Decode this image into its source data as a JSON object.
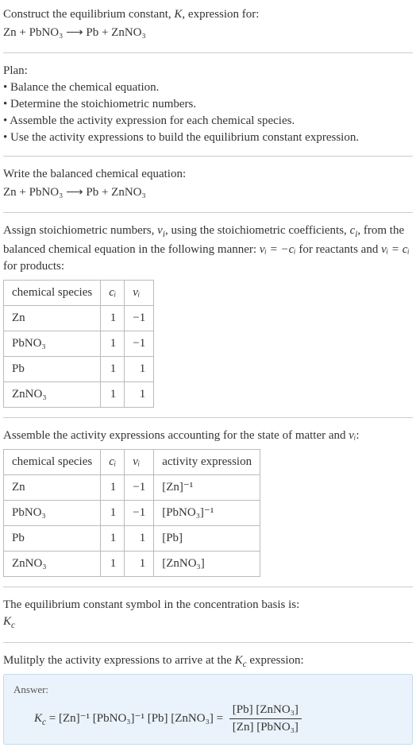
{
  "prompt": {
    "line1_prefix": "Construct the equilibrium constant, ",
    "line1_K": "K",
    "line1_suffix": ", expression for:",
    "reaction": "Zn + PbNO₃  ⟶  Pb + ZnNO₃"
  },
  "plan": {
    "heading": "Plan:",
    "b1": "• Balance the chemical equation.",
    "b2": "• Determine the stoichiometric numbers.",
    "b3": "• Assemble the activity expression for each chemical species.",
    "b4": "• Use the activity expressions to build the equilibrium constant expression."
  },
  "balanced": {
    "heading": "Write the balanced chemical equation:",
    "reaction": "Zn + PbNO₃  ⟶  Pb + ZnNO₃"
  },
  "stoich_intro": {
    "part1": "Assign stoichiometric numbers, ",
    "nu": "ν",
    "sub_i": "i",
    "part2": ", using the stoichiometric coefficients, ",
    "c": "c",
    "part3": ", from the balanced chemical equation in the following manner: ",
    "rel1": "νᵢ = −cᵢ",
    "part4": " for reactants and ",
    "rel2": "νᵢ = cᵢ",
    "part5": " for products:"
  },
  "table1": {
    "h1": "chemical species",
    "h2": "cᵢ",
    "h3": "νᵢ",
    "rows": [
      {
        "sp": "Zn",
        "c": "1",
        "n": "−1"
      },
      {
        "sp": "PbNO₃",
        "c": "1",
        "n": "−1"
      },
      {
        "sp": "Pb",
        "c": "1",
        "n": "1"
      },
      {
        "sp": "ZnNO₃",
        "c": "1",
        "n": "1"
      }
    ]
  },
  "activity_intro": {
    "part1": "Assemble the activity expressions accounting for the state of matter and ",
    "nu": "νᵢ",
    "part2": ":"
  },
  "table2": {
    "h1": "chemical species",
    "h2": "cᵢ",
    "h3": "νᵢ",
    "h4": "activity expression",
    "rows": [
      {
        "sp": "Zn",
        "c": "1",
        "n": "−1",
        "a": "[Zn]⁻¹"
      },
      {
        "sp": "PbNO₃",
        "c": "1",
        "n": "−1",
        "a": "[PbNO₃]⁻¹"
      },
      {
        "sp": "Pb",
        "c": "1",
        "n": "1",
        "a": "[Pb]"
      },
      {
        "sp": "ZnNO₃",
        "c": "1",
        "n": "1",
        "a": "[ZnNO₃]"
      }
    ]
  },
  "symbol_intro": "The equilibrium constant symbol in the concentration basis is:",
  "symbol": "K",
  "symbol_sub": "c",
  "multiply_intro": {
    "part1": "Mulitply the activity expressions to arrive at the ",
    "kc": "K",
    "kc_sub": "c",
    "part2": " expression:"
  },
  "answer": {
    "label": "Answer:",
    "lhs_K": "K",
    "lhs_sub": "c",
    "eq": " = ",
    "rhs_flat": "[Zn]⁻¹ [PbNO₃]⁻¹ [Pb] [ZnNO₃] = ",
    "frac_num": "[Pb] [ZnNO₃]",
    "frac_den": "[Zn] [PbNO₃]"
  }
}
